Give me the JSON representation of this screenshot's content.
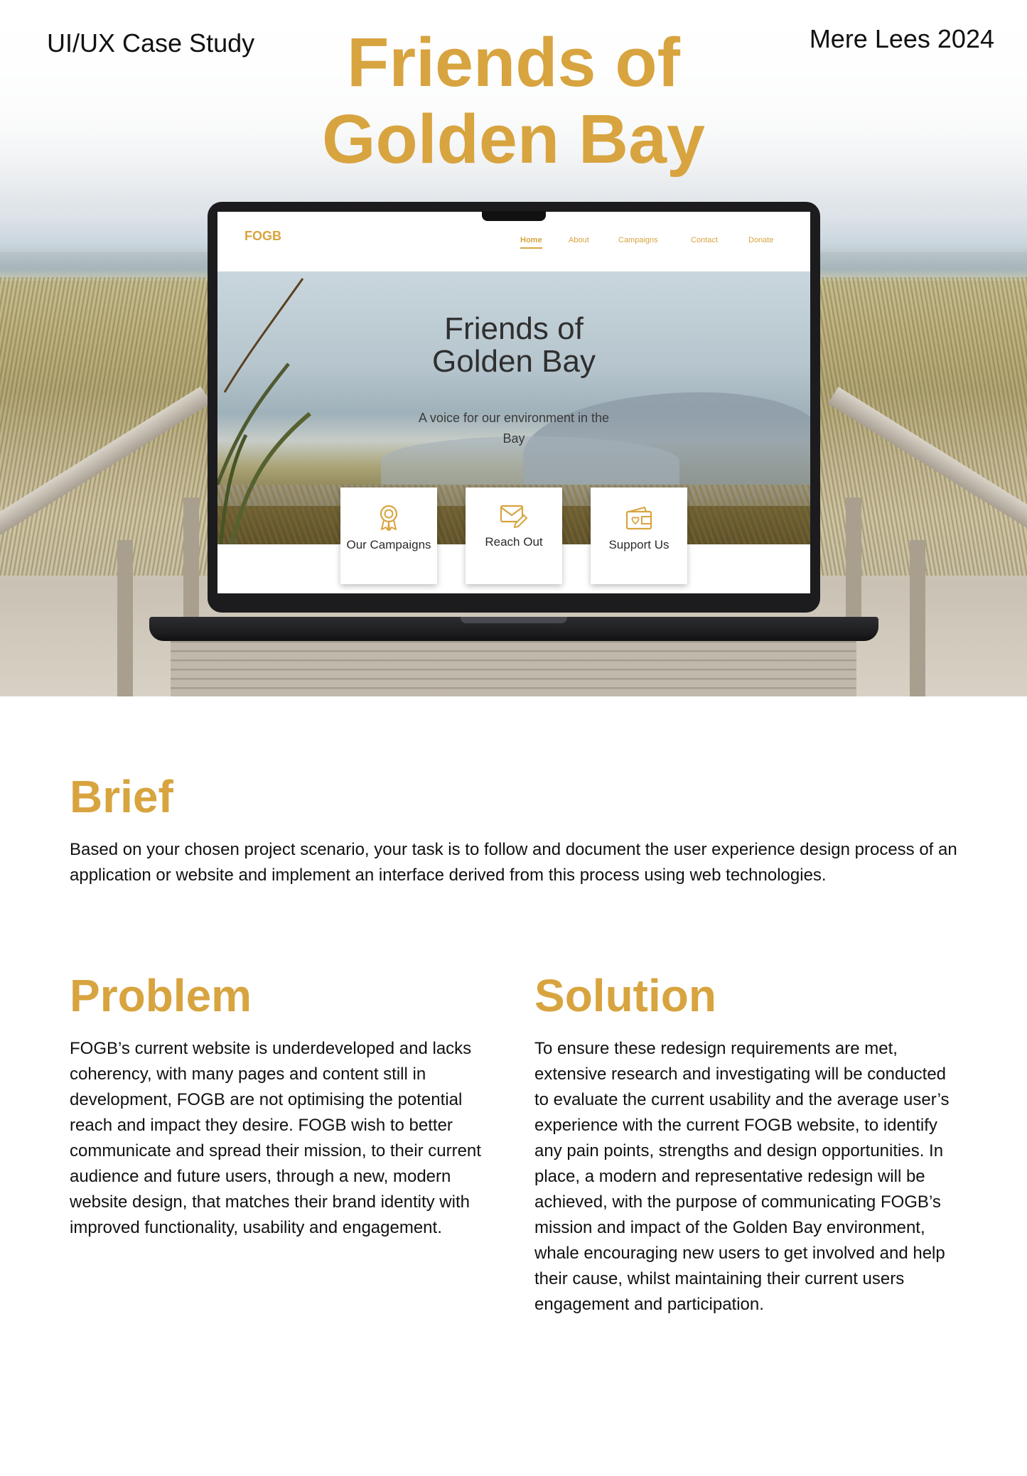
{
  "header": {
    "tag_left": "UI/UX Case Study",
    "tag_right": "Mere Lees 2024",
    "title": "Friends of Golden Bay"
  },
  "mockup": {
    "logo": "FOGB",
    "nav": [
      "Home",
      "About",
      "Campaigns",
      "Contact",
      "Donate"
    ],
    "active_nav": "Home",
    "hero_title": "Friends of Golden Bay",
    "hero_subtitle": "A voice for our environment in the Bay",
    "cards": [
      {
        "label": "Our Campaigns",
        "icon": "award-badge-icon"
      },
      {
        "label": "Reach Out",
        "icon": "mail-pencil-icon"
      },
      {
        "label": "Support Us",
        "icon": "wallet-heart-icon"
      }
    ]
  },
  "brief": {
    "heading": "Brief",
    "text": "Based on your chosen project scenario, your task is to follow and  document the user experience design process of an application or  website and implement an interface derived from this process using  web technologies."
  },
  "problem": {
    "heading": "Problem",
    "text": "FOGB’s current website is underdeveloped and lacks coherency,  with many pages and content still in development, FOGB are  not optimising the potential reach and impact they desire. FOGB wish to better communicate and spread their mission, to their  current audience and future users, through a new, modern  website design, that matches their brand identity with improved functionality, usability and engagement."
  },
  "solution": {
    "heading": "Solution",
    "text": "To ensure these redesign requirements are met, extensive  research and investigating will be conducted to evaluate the  current usability and the average user’s experience with the  current FOGB website, to identify any pain points, strengths  and design opportunities. In place, a modern and representative  redesign will be achieved, with the purpose of communicating FOGB’s mission and impact of the Golden Bay environment,  whale encouraging new users to get involved and help their  cause, whilst maintaining their current users engagement and participation."
  },
  "colors": {
    "accent": "#d8a43f",
    "text": "#111111",
    "laptop": "#1c1c1e"
  }
}
